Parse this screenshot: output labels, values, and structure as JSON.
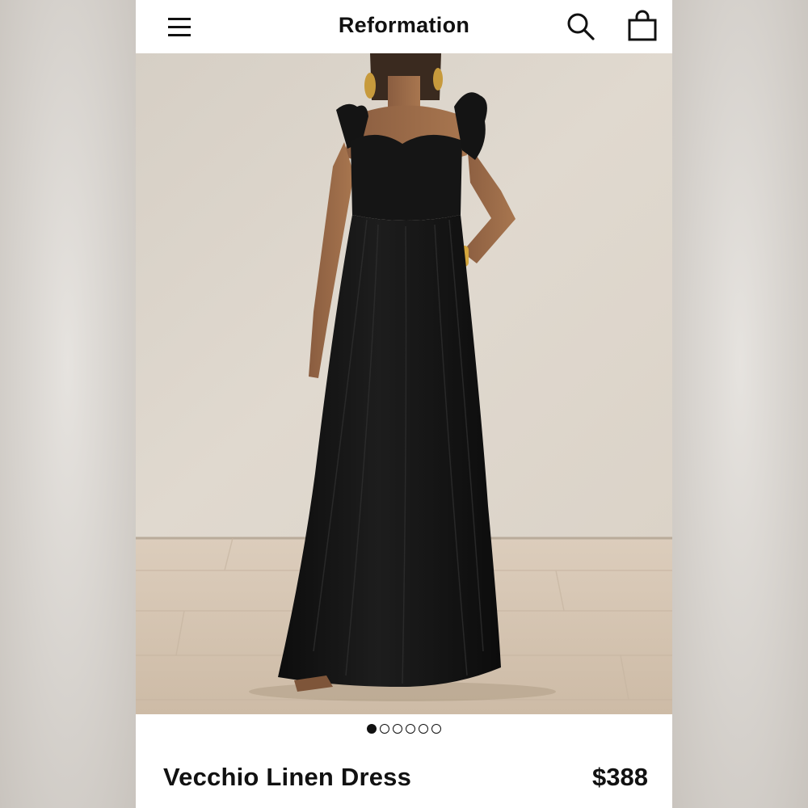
{
  "header": {
    "brand": "Reformation",
    "menu_icon": "hamburger-menu-icon",
    "search_icon": "search-icon",
    "bag_icon": "shopping-bag-icon"
  },
  "gallery": {
    "image_count": 6,
    "active_index": 0
  },
  "product": {
    "name": "Vecchio Linen Dress",
    "price": "$388"
  },
  "colors": {
    "text": "#111111",
    "wall": "#dcd5cc",
    "floor": "#d2c3b2",
    "dress": "#141414"
  }
}
